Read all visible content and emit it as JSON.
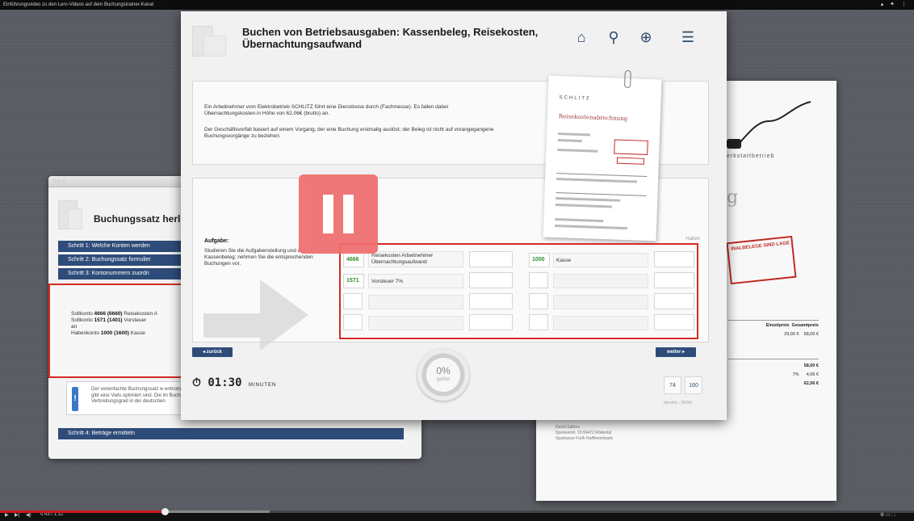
{
  "video": {
    "title": "Einführungsvideo zu den Lern-Videos auf dem Buchungstrainer-Kanal",
    "time": "0:43 / 1:12",
    "progress_fraction": 0.18,
    "buffered_fraction": 0.295
  },
  "main": {
    "title": "Buchen von Betriebsausgaben: Kassenbeleg, Reisekosten, Übernachtungsaufwand",
    "nav_icons": [
      "home-icon",
      "search-icon",
      "help-lifebuoy-icon",
      "menu-icon"
    ],
    "intro_p1": "Ein Arbeitnehmer vom Elektrobetrieb SCHLITZ führt eine Dienstreise durch (Fachmesse). Es fallen dabei Übernachtungskosten in Höhe von 62,06€ (brutto) an.",
    "intro_p2": "Der Geschäftsvorfall basiert auf einem Vorgang, der eine Buchung erstmalig auslöst; der Beleg ist nicht auf vorangegangene Buchungsvorgänge zu beziehen.",
    "receipt": {
      "brand": "SCHLITZ",
      "heading": "Reisekostenabrechnung"
    },
    "task_label": "Aufgabe:",
    "task_text": "Studieren Sie die Aufgabenstellung und den Kassenbeleg; nehmen Sie die entsprechenden Buchungen vor.",
    "haben_label": "Haben",
    "soll_rows": [
      {
        "account": "4666",
        "label": "Reisekosten Arbeitnehmer Übernachtungsaufwand"
      },
      {
        "account": "1571",
        "label": "Vorsteuer 7%"
      }
    ],
    "haben_rows": [
      {
        "account": "1000",
        "label": "Kasse"
      }
    ],
    "back_button": "◂ zurück",
    "next_button": "weiter ▸",
    "timer_value": "01:30",
    "timer_unit": "MINUTEN",
    "gauge_percent": "0%",
    "gauge_label": "gelöst",
    "counter_left": "74",
    "counter_right": "160",
    "ident": "Identifiz.: 38943"
  },
  "left_panel": {
    "title": "Buchungssatz herle",
    "steps": [
      "Schritt 1:   Welche Konten werden",
      "Schritt 2:   Buchungssatz formulier",
      "Schritt 3:   Kontonummern zuordn"
    ],
    "step4": "Schritt 4:   Beträge ermitteln",
    "solution_l1_bold": "4666 (6660)",
    "solution_l1_pre": "Sollkonto ",
    "solution_l1_post": " Reisekosten A",
    "solution_l2_pre": "Sollkonto ",
    "solution_l2_bold": "1571 (1401)",
    "solution_l2_post": " Vorsteuer",
    "solution_l3": "an",
    "solution_l4_pre": "Habenkonto ",
    "solution_l4_bold": "1000 (1600)",
    "solution_l4_post": " Kasse",
    "info_text": "Der vereinfachte Buchungssatz w entnommen sind. Es gibt eine Viels optimiert sind. Die im Buchung Verbreitungsgrad in der deutschen"
  },
  "right_panel": {
    "werkstatt": "erkstattbetrieb",
    "stamp": "INALBELEGE SIND LAGE ZU DIESER RCHNUNG; ALLE UNGSFORMALITÄTEN SIND ERFÜLLT.",
    "table_header": [
      "Einzelpreis",
      "Gesamtpreis"
    ],
    "table_row": [
      "29,00 €",
      "58,00 €"
    ],
    "sum1": "58,00 €",
    "vat": [
      "7%",
      "4,06 €"
    ],
    "total": "62,06 €",
    "footer_name": "David Sabers",
    "footer_addr": "Sponeerstr. 19   96472 Rödental",
    "footer_bank": "Sparkasse Fürth   Raiffeisenbank"
  }
}
